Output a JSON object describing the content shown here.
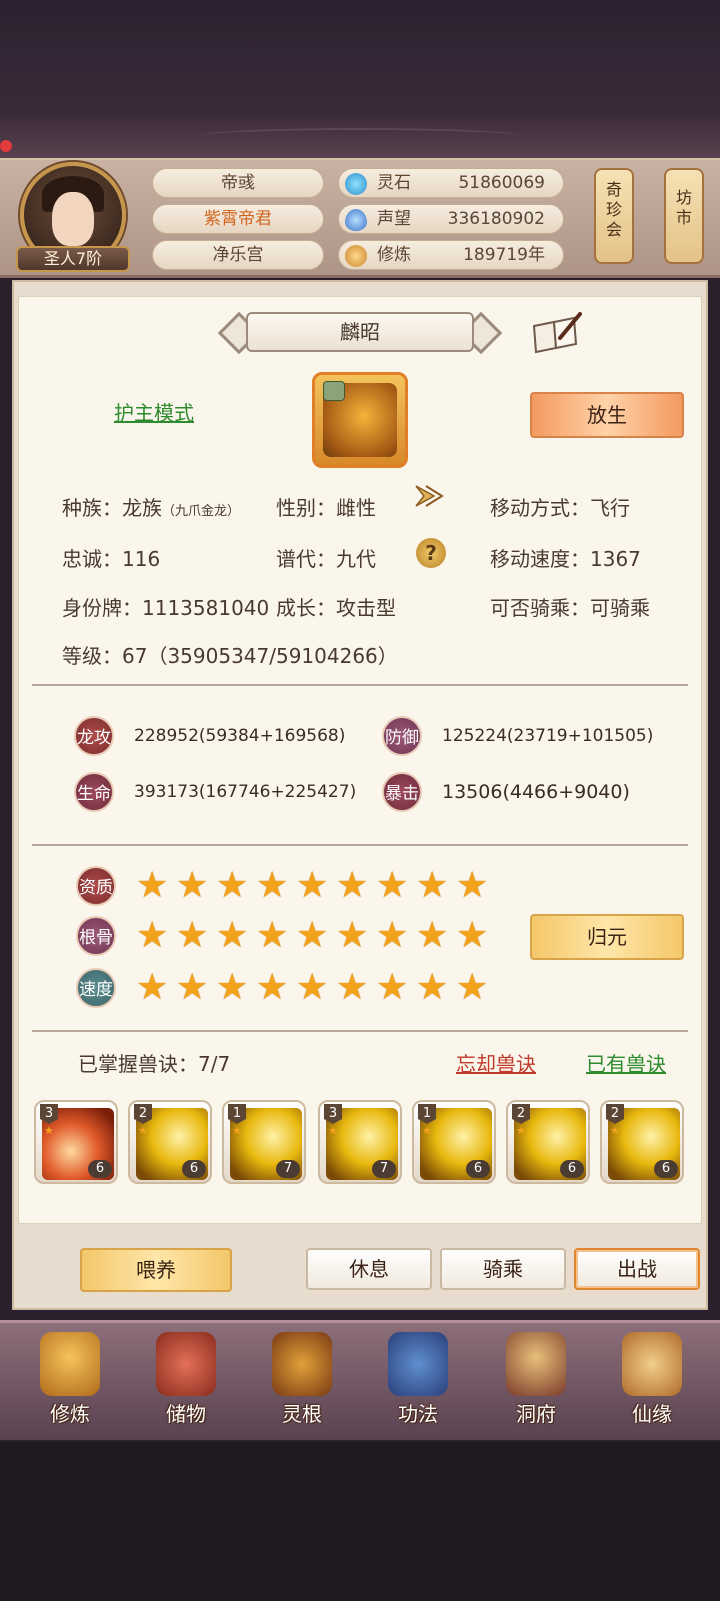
{
  "player": {
    "rank": "圣人7阶",
    "title_line1": "帝彧",
    "title_line2": "紫霄帝君",
    "title_line3": "净乐宫"
  },
  "resources": [
    {
      "icon": "spirit-stone-icon",
      "label": "灵石",
      "value": "51860069"
    },
    {
      "icon": "reputation-icon",
      "label": "声望",
      "value": "336180902"
    },
    {
      "icon": "cultivation-icon",
      "label": "修炼",
      "value": "189719年"
    }
  ],
  "side_buttons": [
    {
      "label": [
        "奇",
        "珍",
        "会"
      ]
    },
    {
      "label": [
        "坊",
        "市"
      ]
    }
  ],
  "pet": {
    "name": "麟昭",
    "mode_link": "护主模式",
    "release_button": "放生",
    "info": {
      "race_label": "种族：龙族",
      "race_sub": "（九爪金龙）",
      "gender": "性别：雌性",
      "move_type": "移动方式：飞行",
      "loyalty": "忠诚：116",
      "generation": "谱代：九代",
      "move_speed": "移动速度：1367",
      "id_tag": "身份牌：1113581040",
      "growth": "成长：攻击型",
      "rideable": "可否骑乘：可骑乘",
      "level": "等级：67（35905347/59104266）"
    },
    "stats": [
      {
        "label": "龙攻",
        "value": "228952(59384+169568)"
      },
      {
        "label": "防御",
        "value": "125224(23719+101505)"
      },
      {
        "label": "生命",
        "value": "393173(167746+225427)"
      },
      {
        "label": "暴击",
        "value": "13506(4466+9040)"
      }
    ],
    "quality": [
      {
        "label": "资质",
        "stars": 9
      },
      {
        "label": "根骨",
        "stars": 9
      },
      {
        "label": "速度",
        "stars": 9
      }
    ],
    "return_button": "归元",
    "skills_mastered": "已掌握兽诀：7/7",
    "forget_link": "忘却兽诀",
    "owned_link": "已有兽诀",
    "skills": [
      {
        "level": "3",
        "count": "6",
        "style": "red"
      },
      {
        "level": "2",
        "count": "6",
        "style": "gold"
      },
      {
        "level": "1",
        "count": "7",
        "style": "gold"
      },
      {
        "level": "3",
        "count": "7",
        "style": "gold"
      },
      {
        "level": "1",
        "count": "6",
        "style": "gold"
      },
      {
        "level": "2",
        "count": "6",
        "style": "gold"
      },
      {
        "level": "2",
        "count": "6",
        "style": "gold"
      }
    ]
  },
  "actions": {
    "feed": "喂养",
    "rest": "休息",
    "ride": "骑乘",
    "battle": "出战"
  },
  "nav": [
    {
      "label": "修炼",
      "icon": "cultivation-figure-icon"
    },
    {
      "label": "储物",
      "icon": "storage-bag-icon"
    },
    {
      "label": "灵根",
      "icon": "spirit-root-icon"
    },
    {
      "label": "功法",
      "icon": "technique-book-icon"
    },
    {
      "label": "洞府",
      "icon": "cave-mansion-icon"
    },
    {
      "label": "仙缘",
      "icon": "immortal-fate-icon"
    }
  ],
  "colors": {
    "accent_orange": "#d2641f",
    "link_green": "#2e8b2e",
    "link_red": "#c0392b",
    "star": "#f3a21b"
  }
}
